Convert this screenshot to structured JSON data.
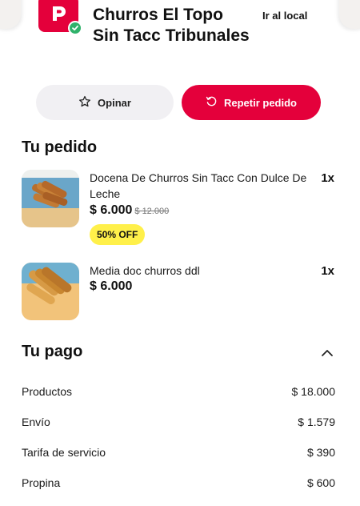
{
  "store": {
    "name": "Churros El Topo Sin Tacc Tribunales",
    "go_to_store": "Ir al local"
  },
  "actions": {
    "review_label": "Opinar",
    "repeat_label": "Repetir pedido"
  },
  "order": {
    "title": "Tu pedido",
    "items": [
      {
        "name": "Docena De Churros Sin Tacc Con Dulce De Leche",
        "price": "$ 6.000",
        "original_price": "$ 12.000",
        "discount": "50% OFF",
        "quantity": "1x"
      },
      {
        "name": "Media doc churros ddl",
        "price": "$ 6.000",
        "quantity": "1x"
      }
    ]
  },
  "payment": {
    "title": "Tu pago",
    "rows": [
      {
        "label": "Productos",
        "value": "$ 18.000"
      },
      {
        "label": "Envío",
        "value": "$ 1.579"
      },
      {
        "label": "Tarifa de servicio",
        "value": "$ 390"
      },
      {
        "label": "Propina",
        "value": "$ 600"
      }
    ]
  },
  "colors": {
    "brand": "#e4003b",
    "discount_badge": "#fff04a",
    "verified": "#2fb26a"
  },
  "icons": {
    "logo": "pedidosya-logo-icon",
    "verified": "check-circle-icon",
    "review": "star-outline-icon",
    "repeat": "refresh-icon",
    "collapse": "chevron-up-icon"
  }
}
